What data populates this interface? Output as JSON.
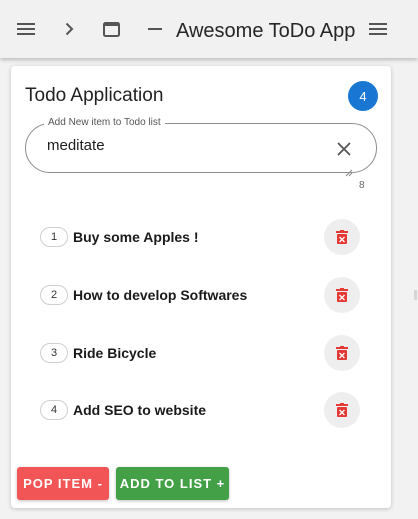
{
  "header": {
    "title": "Awesome ToDo App"
  },
  "card": {
    "title": "Todo Application",
    "count": "4",
    "input": {
      "legend": "Add New item to Todo list",
      "value": "meditate",
      "char_count": "8"
    },
    "items": [
      {
        "num": "1",
        "text": "Buy some Apples !"
      },
      {
        "num": "2",
        "text": "How to develop Softwares"
      },
      {
        "num": "3",
        "text": "Ride Bicycle"
      },
      {
        "num": "4",
        "text": "Add SEO to website"
      }
    ]
  },
  "buttons": {
    "pop_label": "POP ITEM -",
    "add_label": "ADD TO LIST +"
  },
  "colors": {
    "badge": "#1976d2",
    "pop": "#f25555",
    "add": "#43a047",
    "delete_icon": "#e53935"
  },
  "icons": [
    "menu-icon",
    "chevron-right-icon",
    "window-icon",
    "minimize-icon",
    "close-icon",
    "trash-icon"
  ]
}
